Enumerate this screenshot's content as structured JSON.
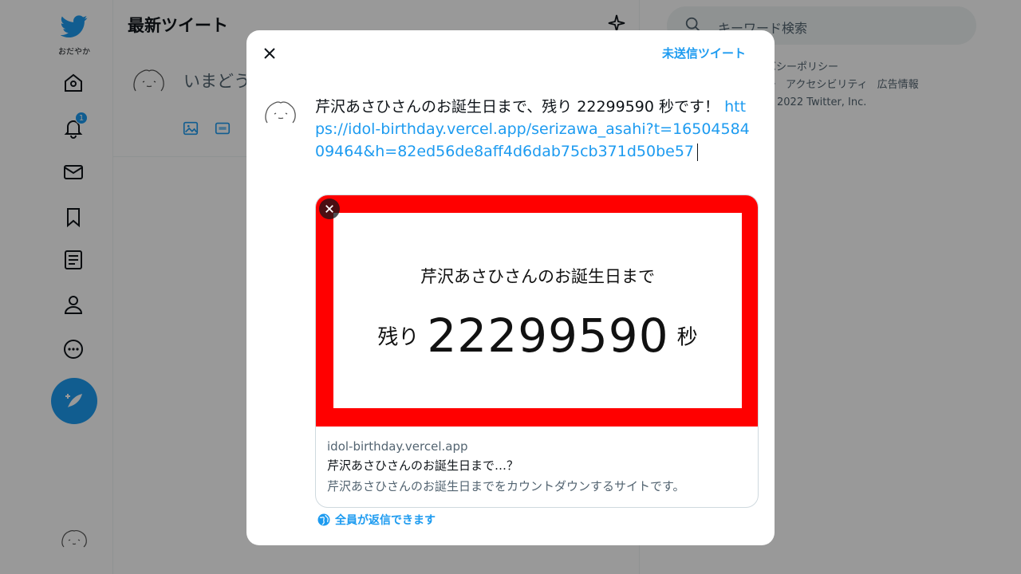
{
  "sidebar": {
    "account_label": "おだやか",
    "notification_count": "1",
    "nav": [
      "home-icon",
      "notifications-icon",
      "messages-icon",
      "bookmarks-icon",
      "lists-icon",
      "profile-icon",
      "more-icon"
    ],
    "compose_icon": "compose-tweet-icon"
  },
  "main": {
    "title": "最新ツイート",
    "compose_placeholder": "いまどう"
  },
  "search": {
    "placeholder": "キーワード検索"
  },
  "footer": {
    "line1": "バシーポリシー",
    "line2a": "ー",
    "line2b": "アクセシビリティ",
    "line2c": "広告情報",
    "line3": "2022 Twitter, Inc."
  },
  "modal": {
    "drafts_label": "未送信ツイート",
    "tweet_text": "芹沢あさひさんのお誕生日まで、残り 22299590 秒です！",
    "tweet_link": "https://idol-birthday.vercel.app/serizawa_asahi?t=1650458409464&h=82ed56de8aff4d6dab75cb371d50be57",
    "card": {
      "image_line1": "芹沢あさひさんのお誕生日まで",
      "image_prefix": "残り",
      "image_number": "22299590",
      "image_suffix": "秒",
      "domain": "idol-birthday.vercel.app",
      "title": "芹沢あさひさんのお誕生日まで…？",
      "description": "芹沢あさひさんのお誕生日までをカウントダウンするサイトです。"
    },
    "reply_setting": "全員が返信できます"
  },
  "colors": {
    "accent": "#1d9bf0",
    "card_frame": "#ff0000"
  }
}
